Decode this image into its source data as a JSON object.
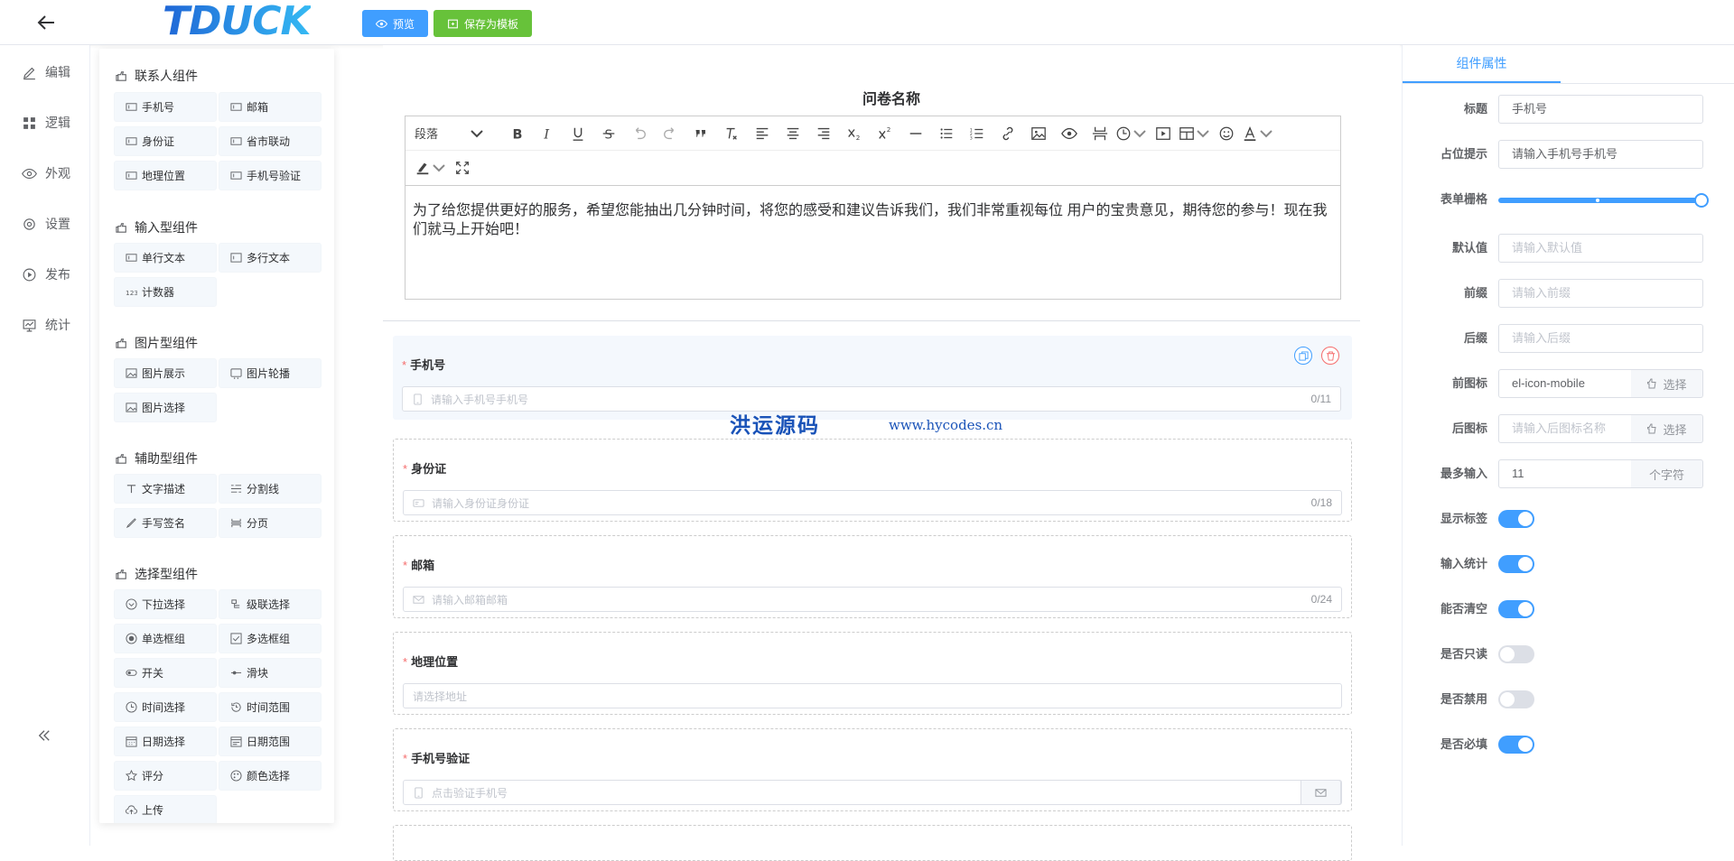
{
  "header": {
    "logo_text": "TDUCK",
    "preview_label": "预览",
    "save_template_label": "保存为模板"
  },
  "nav": {
    "items": [
      {
        "label": "编辑",
        "icon": "edit-icon"
      },
      {
        "label": "逻辑",
        "icon": "grid-icon"
      },
      {
        "label": "外观",
        "icon": "eye-icon"
      },
      {
        "label": "设置",
        "icon": "gear-icon"
      },
      {
        "label": "发布",
        "icon": "play-circle-icon"
      },
      {
        "label": "统计",
        "icon": "chart-icon"
      }
    ]
  },
  "palette": {
    "groups": [
      {
        "title": "联系人组件",
        "items": [
          "手机号",
          "邮箱",
          "身份证",
          "省市联动",
          "地理位置",
          "手机号验证"
        ]
      },
      {
        "title": "输入型组件",
        "items": [
          "单行文本",
          "多行文本",
          "计数器"
        ]
      },
      {
        "title": "图片型组件",
        "items": [
          "图片展示",
          "图片轮播",
          "图片选择"
        ]
      },
      {
        "title": "辅助型组件",
        "items": [
          "文字描述",
          "分割线",
          "手写签名",
          "分页"
        ]
      },
      {
        "title": "选择型组件",
        "items": [
          "下拉选择",
          "级联选择",
          "单选框组",
          "多选框组",
          "开关",
          "滑块",
          "时间选择",
          "时间范围",
          "日期选择",
          "日期范围",
          "评分",
          "颜色选择",
          "上传"
        ]
      }
    ]
  },
  "canvas": {
    "survey_title": "问卷名称",
    "paragraph_select": "段落",
    "intro_text": "为了给您提供更好的服务，希望您能抽出几分钟时间，将您的感受和建议告诉我们，我们非常重视每位 用户的宝贵意见，期待您的参与！现在我们就马上开始吧！",
    "fields": [
      {
        "label": "手机号",
        "placeholder": "请输入手机号手机号",
        "count": "0/11",
        "required": "*"
      },
      {
        "label": "身份证",
        "placeholder": "请输入身份证身份证",
        "count": "0/18",
        "required": "*"
      },
      {
        "label": "邮箱",
        "placeholder": "请输入邮箱邮箱",
        "count": "0/24",
        "required": "*"
      },
      {
        "label": "地理位置",
        "placeholder": "请选择地址",
        "count": "",
        "required": "*"
      },
      {
        "label": "手机号验证",
        "placeholder": "点击验证手机号",
        "count": "",
        "required": "*"
      }
    ]
  },
  "watermark": {
    "text": "洪运源码",
    "url": "www.hycodes.cn"
  },
  "props": {
    "tab_label": "组件属性",
    "title_label": "标题",
    "title_value": "手机号",
    "placeholder_label": "占位提示",
    "placeholder_value": "请输入手机号手机号",
    "grid_label": "表单栅格",
    "grid_value": 1,
    "default_label": "默认值",
    "default_placeholder": "请输入默认值",
    "prefix_label": "前缀",
    "prefix_placeholder": "请输入前缀",
    "suffix_label": "后缀",
    "suffix_placeholder": "请输入后缀",
    "prefix_icon_label": "前图标",
    "prefix_icon_value": "el-icon-mobile",
    "suffix_icon_label": "后图标",
    "suffix_icon_placeholder": "请输入后图标名称",
    "select_label": "选择",
    "maxlength_label": "最多输入",
    "maxlength_value": "11",
    "maxlength_unit": "个字符",
    "switches": [
      {
        "label": "显示标签",
        "on": true
      },
      {
        "label": "输入统计",
        "on": true
      },
      {
        "label": "能否清空",
        "on": true
      },
      {
        "label": "是否只读",
        "on": false
      },
      {
        "label": "是否禁用",
        "on": false
      },
      {
        "label": "是否必填",
        "on": true
      }
    ]
  },
  "colors": {
    "primary": "#409eff",
    "success": "#67c23a",
    "danger": "#f56c6c"
  }
}
